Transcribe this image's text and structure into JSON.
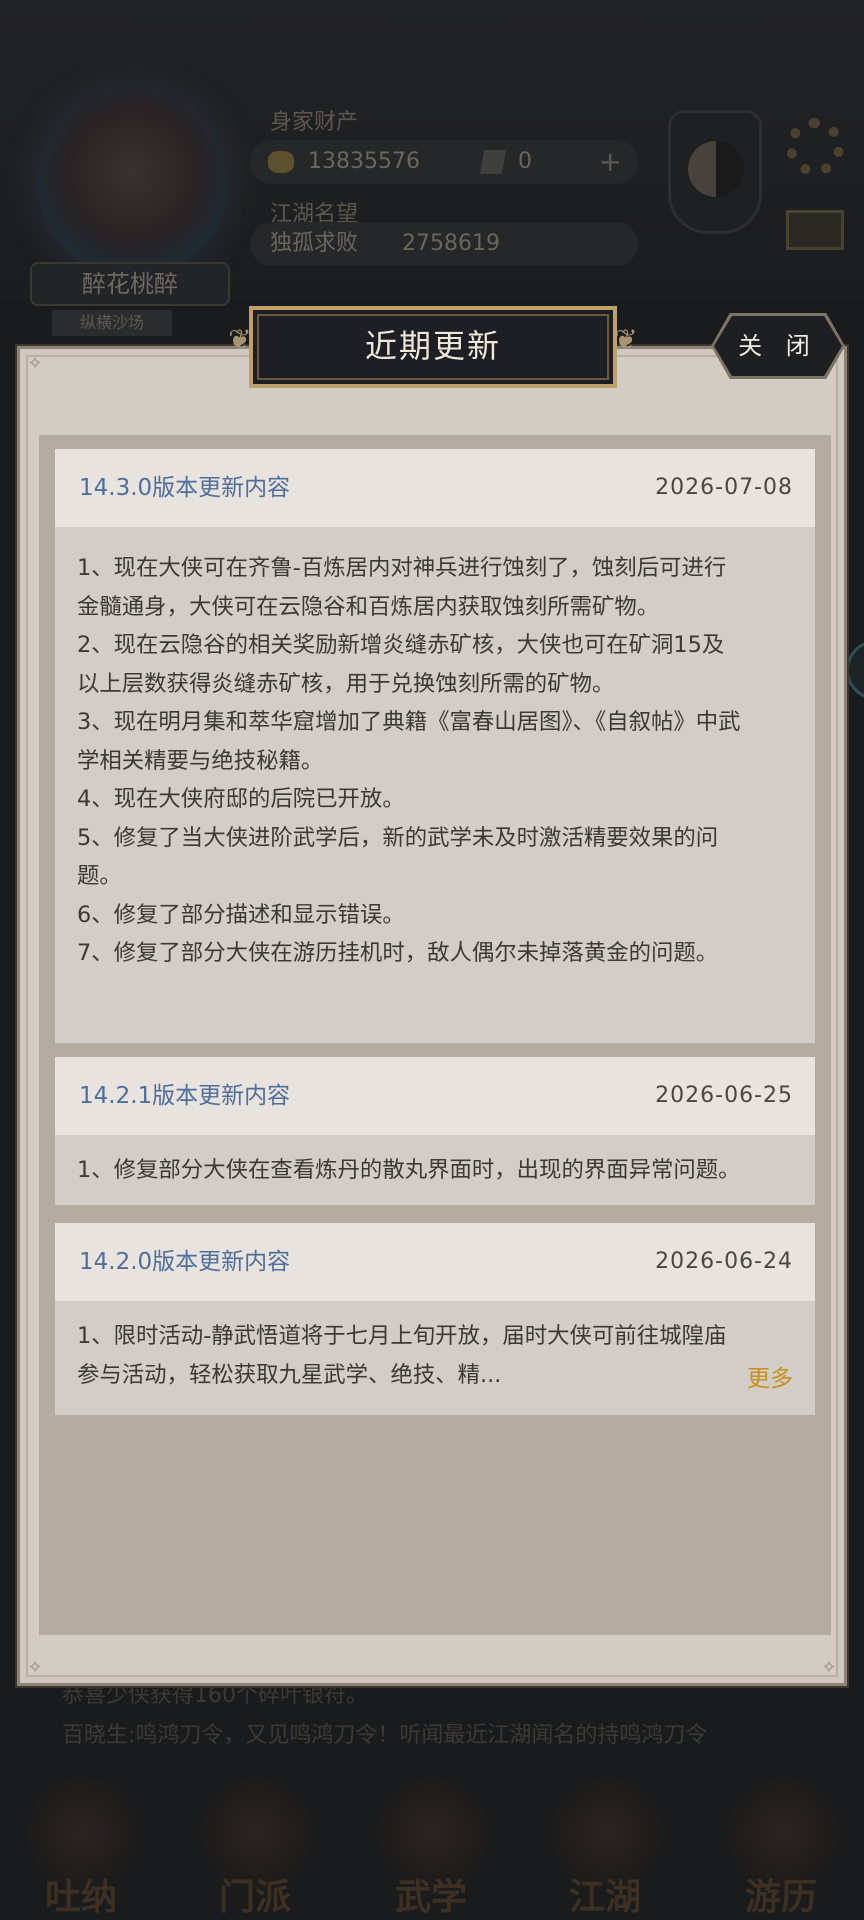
{
  "background": {
    "player_name": "醉花桃醉",
    "player_title": "纵横沙场",
    "wealth_label": "身家财产",
    "gold": "13835576",
    "gems": "0",
    "fame_label": "江湖名望",
    "fame_rank": "独孤求败",
    "fame_value": "2758619",
    "news_line_1": "恭喜少侠获得160个碎叶银符。",
    "news_line_2": "百晓生:鸣鸿刀令，又见鸣鸿刀令！听闻最近江湖闻名的持鸣鸿刀令",
    "nav": [
      {
        "label": "吐纳"
      },
      {
        "label": "门派"
      },
      {
        "label": "武学"
      },
      {
        "label": "江湖"
      },
      {
        "label": "游历"
      }
    ]
  },
  "modal": {
    "title": "近期更新",
    "close_label": "关 闭",
    "updates": [
      {
        "version": "14.3.0版本更新内容",
        "date": "2026-07-08",
        "lines": [
          "1、现在大侠可在齐鲁-百炼居内对神兵进行蚀刻了，蚀刻后可进行",
          "金髓通身，大侠可在云隐谷和百炼居内获取蚀刻所需矿物。",
          "2、现在云隐谷的相关奖励新增炎缝赤矿核，大侠也可在矿洞15及",
          "以上层数获得炎缝赤矿核，用于兑换蚀刻所需的矿物。",
          "3、现在明月集和萃华窟增加了典籍《富春山居图》、《自叙帖》中武",
          "学相关精要与绝技秘籍。",
          "4、现在大侠府邸的后院已开放。",
          "5、修复了当大侠进阶武学后，新的武学未及时激活精要效果的问",
          "题。",
          "6、修复了部分描述和显示错误。",
          "7、修复了部分大侠在游历挂机时，敌人偶尔未掉落黄金的问题。"
        ]
      },
      {
        "version": "14.2.1版本更新内容",
        "date": "2026-06-25",
        "lines": [
          "1、修复部分大侠在查看炼丹的散丸界面时，出现的界面异常问题。"
        ]
      },
      {
        "version": "14.2.0版本更新内容",
        "date": "2026-06-24",
        "lines": [
          "1、限时活动-静武悟道将于七月上旬开放，届时大侠可前往城隍庙",
          "参与活动，轻松获取九星武学、绝技、精..."
        ],
        "more_label": "更多"
      }
    ]
  }
}
